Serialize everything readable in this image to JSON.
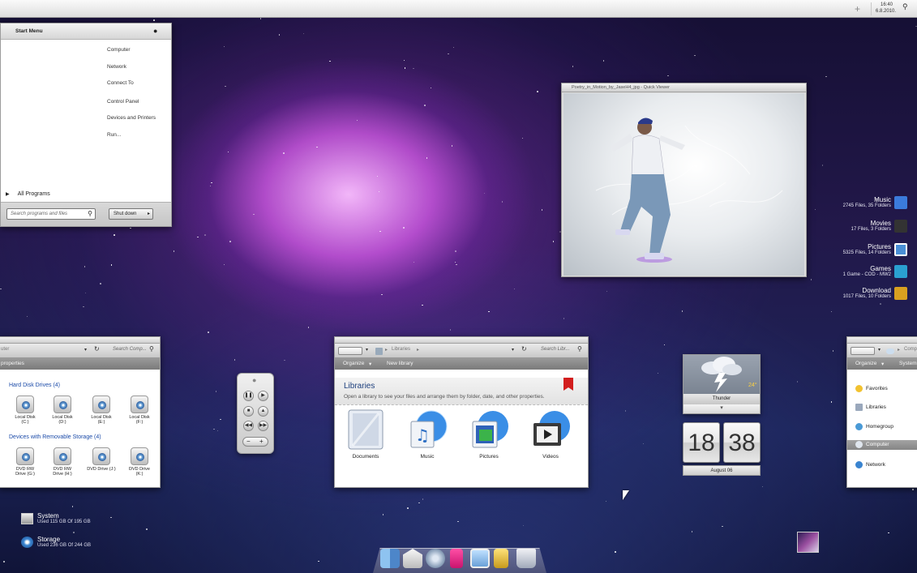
{
  "menubar": {
    "time": "16:40",
    "date": "6.8.2010.",
    "plus_icon": "plus-icon",
    "search_icon": "search-icon"
  },
  "start_menu": {
    "title": "Start Menu",
    "items": [
      "Computer",
      "Network",
      "Connect To",
      "Control Panel",
      "Devices and Printers",
      "Run..."
    ],
    "all_programs": "All Programs",
    "search_placeholder": "Search programs and files",
    "shutdown_label": "Shut down"
  },
  "viewer": {
    "title": "Poetry_in_Motion_by_JaseH4_jpg - Quick Viewer"
  },
  "libraries_side": [
    {
      "name": "Music",
      "stats": "2745 Files, 35 Folders",
      "icon": "music-icon",
      "color": "#3b7bdc"
    },
    {
      "name": "Movies",
      "stats": "17 Files, 3 Folders",
      "icon": "film-icon",
      "color": "#333333"
    },
    {
      "name": "Pictures",
      "stats": "5325 Files, 14 Folders",
      "icon": "picture-icon",
      "color": "#4a8fd6"
    },
    {
      "name": "Games",
      "stats": "1 Game - COD - MW2",
      "icon": "games-icon",
      "color": "#2aa0d0"
    },
    {
      "name": "Download",
      "stats": "1017 Files, 10 Folders",
      "icon": "download-icon",
      "color": "#d9a020"
    }
  ],
  "explorer_left": {
    "address": "uter",
    "search_placeholder": "Search Comp...",
    "cmd_properties": "properties",
    "group_hdd": "Hard Disk Drives (4)",
    "hdd": [
      {
        "label": "Local Disk",
        "sub": "(C:)"
      },
      {
        "label": "Local Disk",
        "sub": "(D:)"
      },
      {
        "label": "Local Disk",
        "sub": "(E:)"
      },
      {
        "label": "Local Disk",
        "sub": "(F:)"
      }
    ],
    "group_removable": "Devices with Removable Storage (4)",
    "removable": [
      {
        "label": "DVD RW",
        "sub": "Drive (G:)"
      },
      {
        "label": "DVD RW",
        "sub": "Drive (H:)"
      },
      {
        "label": "DVD Drive (J:)",
        "sub": ""
      },
      {
        "label": "DVD Drive",
        "sub": "(K:)"
      }
    ]
  },
  "explorer_center": {
    "address": "Libraries",
    "search_placeholder": "Search Libr...",
    "cmd_organize": "Organize",
    "cmd_new_library": "New library",
    "header_title": "Libraries",
    "header_desc": "Open a library to see your files and arrange them by folder, date, and other properties.",
    "items": [
      {
        "label": "Documents",
        "icon": "documents-library-icon"
      },
      {
        "label": "Music",
        "icon": "music-library-icon"
      },
      {
        "label": "Pictures",
        "icon": "pictures-library-icon"
      },
      {
        "label": "Videos",
        "icon": "videos-library-icon"
      }
    ]
  },
  "explorer_right": {
    "address": "Comp",
    "cmd_organize": "Organize",
    "cmd_system": "System",
    "nav": [
      "Favorites",
      "Libraries",
      "Homegroup",
      "Computer",
      "Network"
    ]
  },
  "weather": {
    "temp": "24°",
    "condition": "Thunder"
  },
  "clock": {
    "hour": "18",
    "minute": "38",
    "date": "August 06"
  },
  "system_status": [
    {
      "name": "System",
      "detail": "Used 115 GB Of 195 GB",
      "icon": "system-icon"
    },
    {
      "name": "Storage",
      "detail": "Used 236 GB Of 244 GB",
      "icon": "storage-icon"
    }
  ],
  "dock": [
    "finder-icon",
    "mail-icon",
    "safari-icon",
    "ipod-icon",
    "preview-icon",
    "utilities-icon",
    "trash-icon"
  ]
}
